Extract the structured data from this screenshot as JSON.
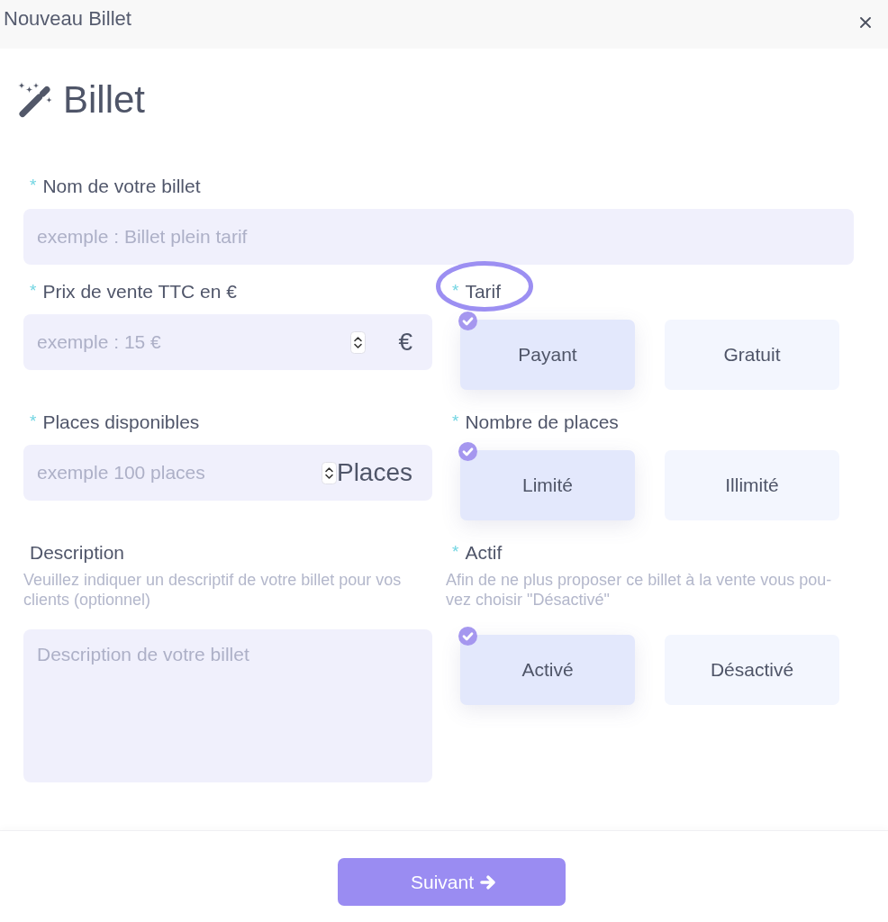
{
  "dialog": {
    "title": "Nouveau Billet"
  },
  "heading": {
    "title": "Billet"
  },
  "name_field": {
    "required_mark": "*",
    "label": "Nom de votre billet",
    "placeholder": "exemple : Billet plein tarif"
  },
  "left_fields": [
    {
      "kind": "number",
      "required_mark": "*",
      "label": "Prix de vente TTC en €",
      "placeholder": "exemple : 15 €",
      "unit": "€"
    },
    {
      "kind": "number",
      "required_mark": "*",
      "label": "Places disponibles",
      "placeholder": "exemple 100 places",
      "unit": "Places"
    },
    {
      "kind": "textarea",
      "label": "Description",
      "help": "Veuillez indiquer un descriptif de votre billet pour vos clients (optionnel)",
      "placeholder": "Description de votre billet"
    }
  ],
  "right_fields": [
    {
      "required_mark": "*",
      "label": "Tarif",
      "highlighted": true,
      "options": [
        {
          "label": "Payant",
          "selected": true
        },
        {
          "label": "Gratuit",
          "selected": false
        }
      ]
    },
    {
      "required_mark": "*",
      "label": "Nombre de places",
      "highlighted": false,
      "options": [
        {
          "label": "Limité",
          "selected": true
        },
        {
          "label": "Illimité",
          "selected": false
        }
      ]
    },
    {
      "required_mark": "*",
      "label": "Actif",
      "highlighted": false,
      "help": "Afin de ne plus proposer ce billet à la vente vous pou-vez choisir \"Désactivé\"",
      "options": [
        {
          "label": "Activé",
          "selected": true
        },
        {
          "label": "Désactivé",
          "selected": false
        }
      ]
    }
  ],
  "footer": {
    "next_button": "Suivant"
  }
}
